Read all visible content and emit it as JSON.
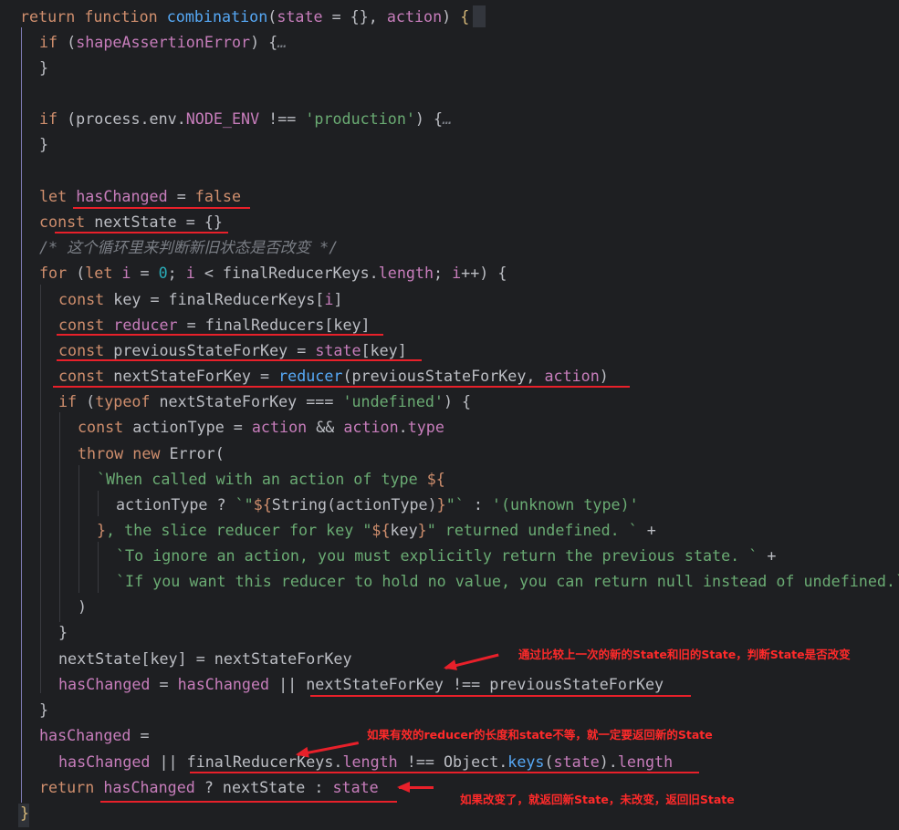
{
  "editor": {
    "lines": [
      [
        [
          "kw",
          "return "
        ],
        [
          "kw",
          "function "
        ],
        [
          "fn",
          "combination"
        ],
        [
          "plain",
          "("
        ],
        [
          "var",
          "state"
        ],
        [
          "plain",
          " = {}, "
        ],
        [
          "var",
          "action"
        ],
        [
          "plain",
          ") "
        ],
        [
          "brace",
          "{"
        ]
      ],
      [
        [
          "kw",
          "if "
        ],
        [
          "plain",
          "("
        ],
        [
          "var",
          "shapeAssertionError"
        ],
        [
          "plain",
          ") {"
        ],
        [
          "cm",
          "…"
        ]
      ],
      [
        [
          "plain",
          "}"
        ]
      ],
      [],
      [
        [
          "kw",
          "if "
        ],
        [
          "plain",
          "(process.env."
        ],
        [
          "const",
          "NODE_ENV"
        ],
        [
          "plain",
          " !== "
        ],
        [
          "str",
          "'production'"
        ],
        [
          "plain",
          ") {"
        ],
        [
          "cm",
          "…"
        ]
      ],
      [
        [
          "plain",
          "}"
        ]
      ],
      [],
      [
        [
          "kw",
          "let "
        ],
        [
          "var",
          "hasChanged"
        ],
        [
          "plain",
          " = "
        ],
        [
          "kw",
          "false"
        ]
      ],
      [
        [
          "kw",
          "const "
        ],
        [
          "plain",
          "nextState = {}"
        ]
      ],
      [
        [
          "cm",
          "/* 这个循环里来判断新旧状态是否改变 */"
        ]
      ],
      [
        [
          "kw",
          "for "
        ],
        [
          "plain",
          "("
        ],
        [
          "kw",
          "let "
        ],
        [
          "var",
          "i"
        ],
        [
          "plain",
          " = "
        ],
        [
          "num",
          "0"
        ],
        [
          "plain",
          "; "
        ],
        [
          "var",
          "i"
        ],
        [
          "plain",
          " < finalReducerKeys."
        ],
        [
          "var",
          "length"
        ],
        [
          "plain",
          "; "
        ],
        [
          "var",
          "i"
        ],
        [
          "plain",
          "++) {"
        ]
      ],
      [
        [
          "kw",
          "const "
        ],
        [
          "plain",
          "key = finalReducerKeys["
        ],
        [
          "var",
          "i"
        ],
        [
          "plain",
          "]"
        ]
      ],
      [
        [
          "kw",
          "const "
        ],
        [
          "var",
          "reducer"
        ],
        [
          "plain",
          " = finalReducers[key]"
        ]
      ],
      [
        [
          "kw",
          "const "
        ],
        [
          "plain",
          "previousStateForKey = "
        ],
        [
          "var",
          "state"
        ],
        [
          "plain",
          "[key]"
        ]
      ],
      [
        [
          "kw",
          "const "
        ],
        [
          "plain",
          "nextStateForKey = "
        ],
        [
          "fn",
          "reducer"
        ],
        [
          "plain",
          "(previousStateForKey, "
        ],
        [
          "var",
          "action"
        ],
        [
          "plain",
          ")"
        ]
      ],
      [
        [
          "kw",
          "if "
        ],
        [
          "plain",
          "("
        ],
        [
          "kw",
          "typeof "
        ],
        [
          "plain",
          "nextStateForKey === "
        ],
        [
          "str",
          "'undefined'"
        ],
        [
          "plain",
          ") {"
        ]
      ],
      [
        [
          "kw",
          "const "
        ],
        [
          "plain",
          "actionType = "
        ],
        [
          "var",
          "action"
        ],
        [
          "plain",
          " && "
        ],
        [
          "var",
          "action"
        ],
        [
          "plain",
          "."
        ],
        [
          "var",
          "type"
        ]
      ],
      [
        [
          "kw",
          "throw new "
        ],
        [
          "plain",
          "Error("
        ]
      ],
      [
        [
          "str",
          "`When called with an action of type "
        ],
        [
          "kw",
          "${"
        ]
      ],
      [
        [
          "plain",
          "actionType ? "
        ],
        [
          "str",
          "`\""
        ],
        [
          "kw",
          "${"
        ],
        [
          "plain",
          "String(actionType)"
        ],
        [
          "kw",
          "}"
        ],
        [
          "str",
          "\"`"
        ],
        [
          "plain",
          " : "
        ],
        [
          "str",
          "'(unknown type)'"
        ]
      ],
      [
        [
          "kw",
          "}"
        ],
        [
          "str",
          ", the slice reducer for key \""
        ],
        [
          "kw",
          "${"
        ],
        [
          "plain",
          "key"
        ],
        [
          "kw",
          "}"
        ],
        [
          "str",
          "\" returned undefined. `"
        ],
        [
          "plain",
          " +"
        ]
      ],
      [
        [
          "str",
          "`To ignore an action, you must explicitly return the previous state. `"
        ],
        [
          "plain",
          " +"
        ]
      ],
      [
        [
          "str",
          "`If you want this reducer to hold no value, you can return null instead of undefined.`"
        ]
      ],
      [
        [
          "plain",
          ")"
        ]
      ],
      [
        [
          "plain",
          "}"
        ]
      ],
      [
        [
          "plain",
          "nextState[key] = nextStateForKey"
        ]
      ],
      [
        [
          "var",
          "hasChanged"
        ],
        [
          "plain",
          " = "
        ],
        [
          "var",
          "hasChanged"
        ],
        [
          "plain",
          " || nextStateForKey !== previousStateForKey"
        ]
      ],
      [
        [
          "plain",
          "}"
        ]
      ],
      [
        [
          "var",
          "hasChanged"
        ],
        [
          "plain",
          " ="
        ]
      ],
      [
        [
          "var",
          "hasChanged"
        ],
        [
          "plain",
          " || finalReducerKeys."
        ],
        [
          "var",
          "length"
        ],
        [
          "plain",
          " !== Object."
        ],
        [
          "fn",
          "keys"
        ],
        [
          "plain",
          "("
        ],
        [
          "var",
          "state"
        ],
        [
          "plain",
          ")."
        ],
        [
          "var",
          "length"
        ]
      ],
      [
        [
          "kw",
          "return "
        ],
        [
          "var",
          "hasChanged"
        ],
        [
          "plain",
          " ? nextState : "
        ],
        [
          "var",
          "state"
        ]
      ],
      [
        [
          "brace",
          "}"
        ]
      ]
    ]
  },
  "annotations": {
    "note1": "通过比较上一次的新的State和旧的State，判断State是否改变",
    "note2": "如果有效的reducer的长度和state不等，就一定要返回新的State",
    "note3": "如果改变了，就返回新State，未改变，返回旧State"
  },
  "colors": {
    "background": "#1e1f22",
    "keyword": "#cf8e6d",
    "function": "#56a8f5",
    "variable": "#c77dbb",
    "string": "#6aab73",
    "comment": "#7a7e85",
    "annotation": "#e8202a"
  }
}
